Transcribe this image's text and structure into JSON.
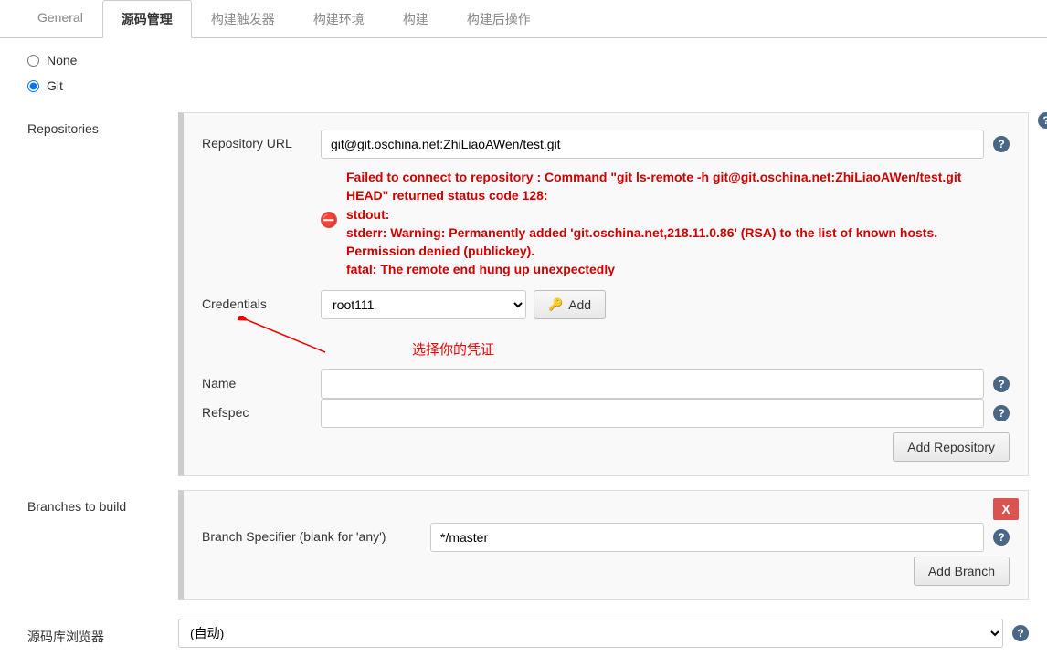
{
  "tabs": [
    {
      "label": "General"
    },
    {
      "label": "源码管理"
    },
    {
      "label": "构建触发器"
    },
    {
      "label": "构建环境"
    },
    {
      "label": "构建"
    },
    {
      "label": "构建后操作"
    }
  ],
  "scm": {
    "none_label": "None",
    "git_label": "Git"
  },
  "repositories": {
    "section_label": "Repositories",
    "url_label": "Repository URL",
    "url_value": "git@git.oschina.net:ZhiLiaoAWen/test.git",
    "error": "Failed to connect to repository : Command \"git ls-remote -h git@git.oschina.net:ZhiLiaoAWen/test.git HEAD\" returned status code 128:\nstdout:\nstderr: Warning: Permanently added 'git.oschina.net,218.11.0.86' (RSA) to the list of known hosts.\nPermission denied (publickey).\nfatal: The remote end hung up unexpectedly",
    "credentials_label": "Credentials",
    "credentials_value": "root111",
    "add_button": "Add",
    "name_label": "Name",
    "name_value": "",
    "refspec_label": "Refspec",
    "refspec_value": "",
    "add_repo_button": "Add Repository",
    "annotation": "选择你的凭证"
  },
  "branches": {
    "section_label": "Branches to build",
    "specifier_label": "Branch Specifier (blank for 'any')",
    "specifier_value": "*/master",
    "close_label": "X",
    "add_branch_button": "Add Branch"
  },
  "browser": {
    "section_label": "源码库浏览器",
    "value": "(自动)"
  },
  "help_char": "?"
}
